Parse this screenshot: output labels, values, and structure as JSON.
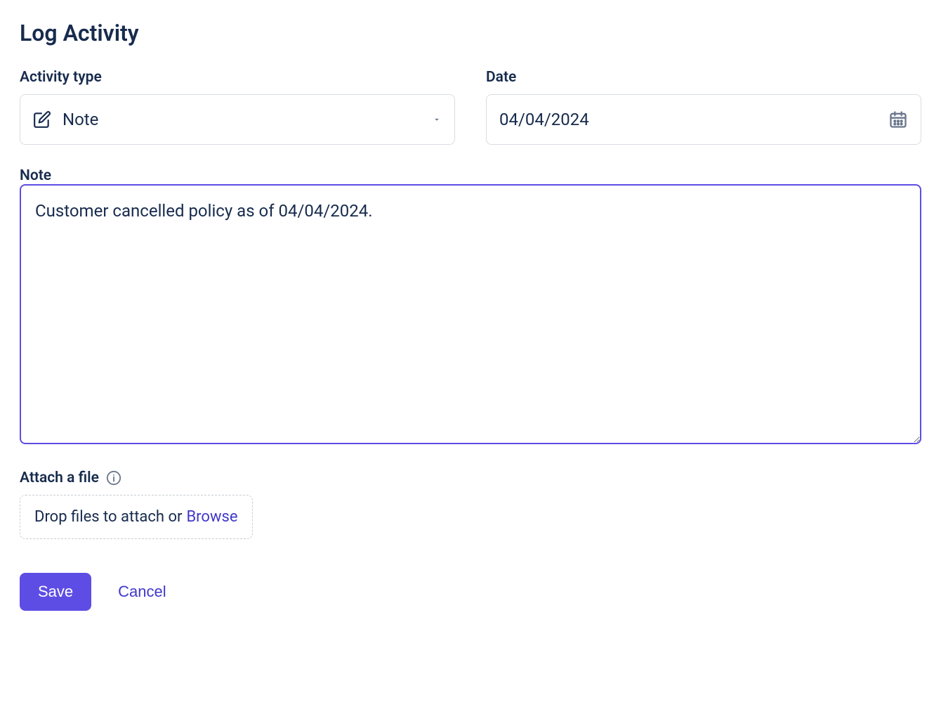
{
  "title": "Log Activity",
  "fields": {
    "activity_type": {
      "label": "Activity type",
      "value": "Note"
    },
    "date": {
      "label": "Date",
      "value": "04/04/2024"
    },
    "note": {
      "label": "Note",
      "value": "Customer cancelled policy as of 04/04/2024. "
    },
    "attach": {
      "label": "Attach a file",
      "drop_text": "Drop files to attach or",
      "browse_text": "Browse"
    }
  },
  "buttons": {
    "save": "Save",
    "cancel": "Cancel"
  }
}
